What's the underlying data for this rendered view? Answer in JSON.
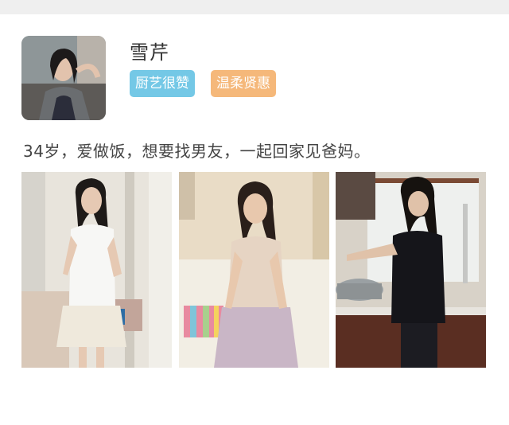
{
  "profile": {
    "name": "雪芹",
    "tags": [
      {
        "label": "厨艺很赞",
        "color": "#74c8e6"
      },
      {
        "label": "温柔贤惠",
        "color": "#f5b87a"
      }
    ],
    "bio": "34岁，爱做饭，想要找男友，一起回家见爸妈。"
  },
  "icons": {
    "avatar": "profile-photo",
    "photos": [
      "photo-standing-hallway",
      "photo-seated-sofa",
      "photo-kitchen"
    ]
  }
}
